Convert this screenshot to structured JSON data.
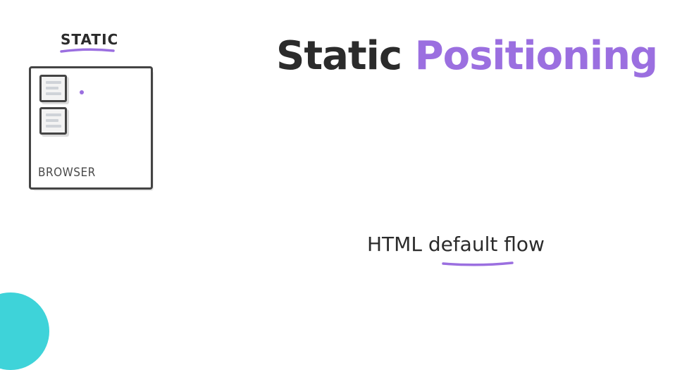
{
  "diagram": {
    "label": "STATIC",
    "browser_label": "BROWSER"
  },
  "title": {
    "word1": "Static",
    "word2": "Positioning"
  },
  "subtitle": {
    "prefix": "HTML",
    "highlight": "default",
    "suffix": "flow"
  },
  "colors": {
    "accent": "#9b6fe0",
    "text": "#2b2b2b",
    "teal": "#3ed3d9"
  }
}
